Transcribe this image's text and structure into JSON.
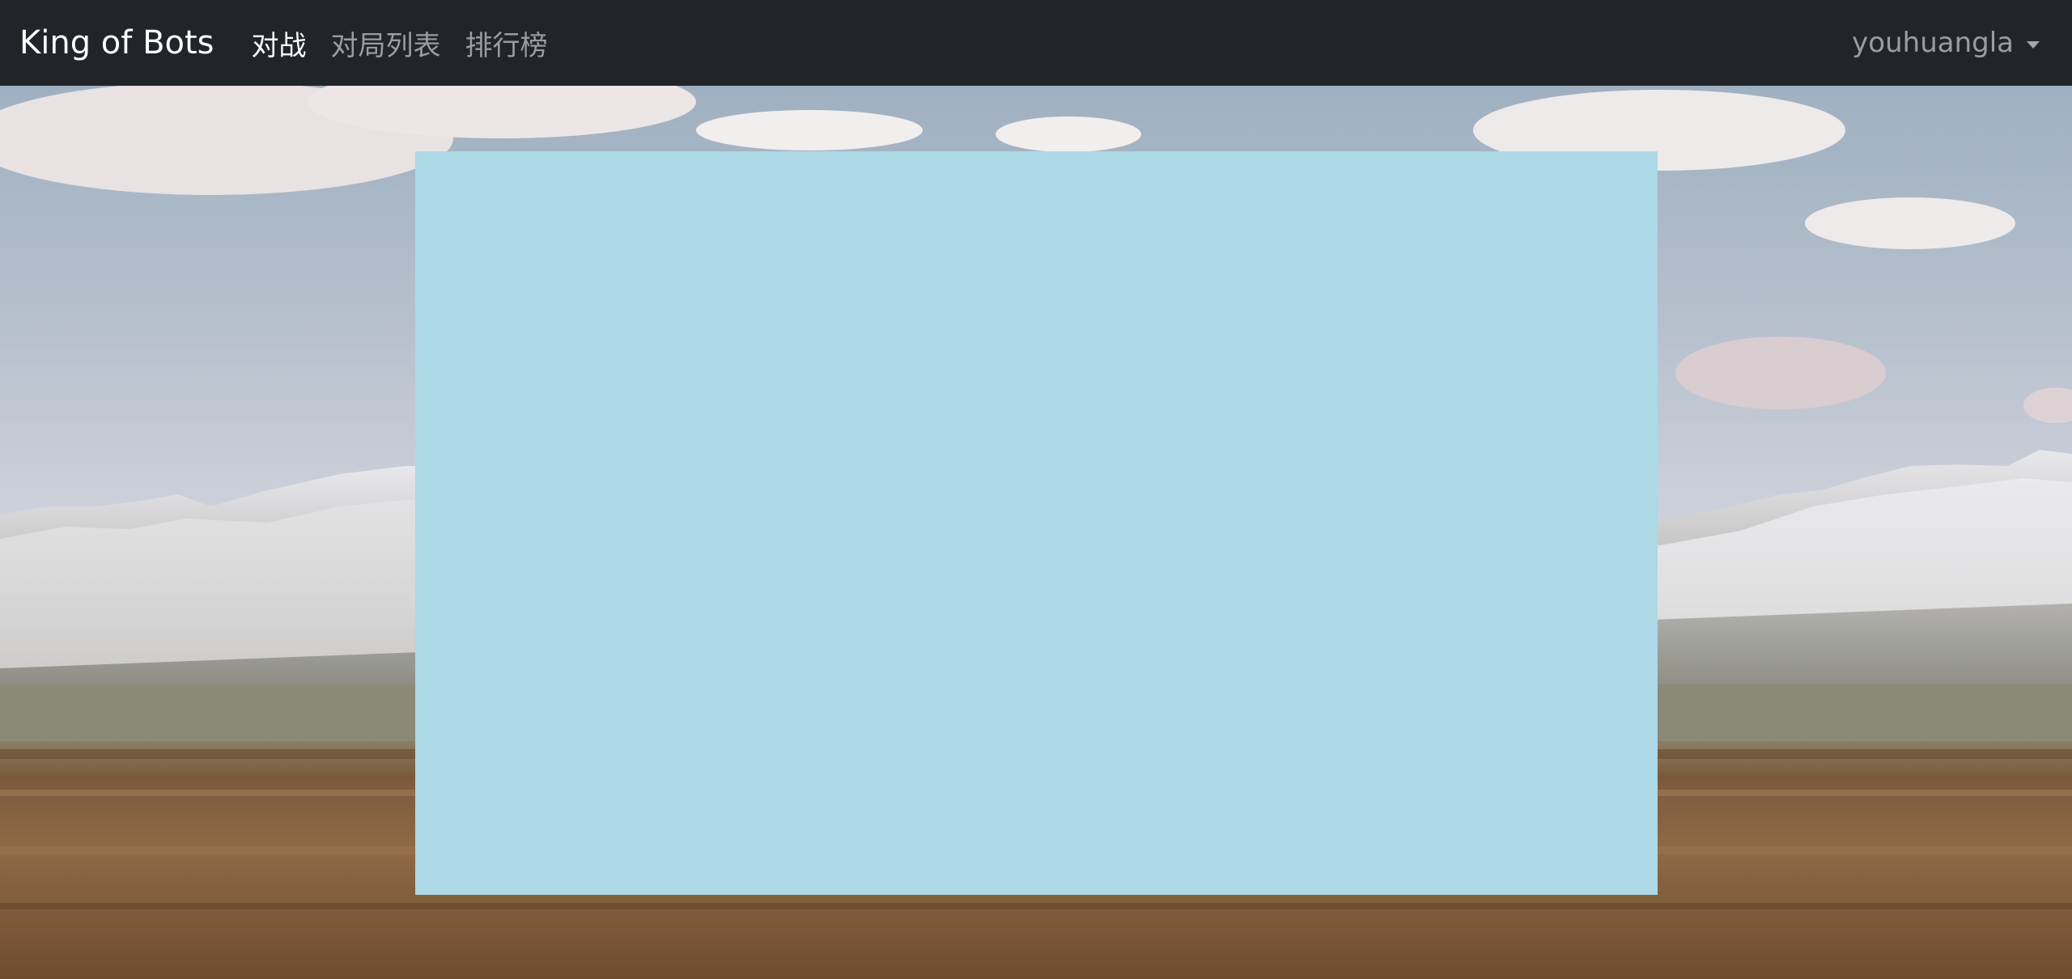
{
  "navbar": {
    "brand": "King of Bots",
    "links": [
      {
        "label": "对战",
        "active": true
      },
      {
        "label": "对局列表",
        "active": false
      },
      {
        "label": "排行榜",
        "active": false
      }
    ],
    "user": {
      "username": "youhuangla",
      "menu_icon": "caret-down-icon"
    }
  },
  "background": {
    "scene": "mountain-landscape"
  },
  "game_board": {
    "color": "#add8e6"
  },
  "colors": {
    "navbar_bg": "#212529",
    "board_bg": "#add8e6"
  }
}
